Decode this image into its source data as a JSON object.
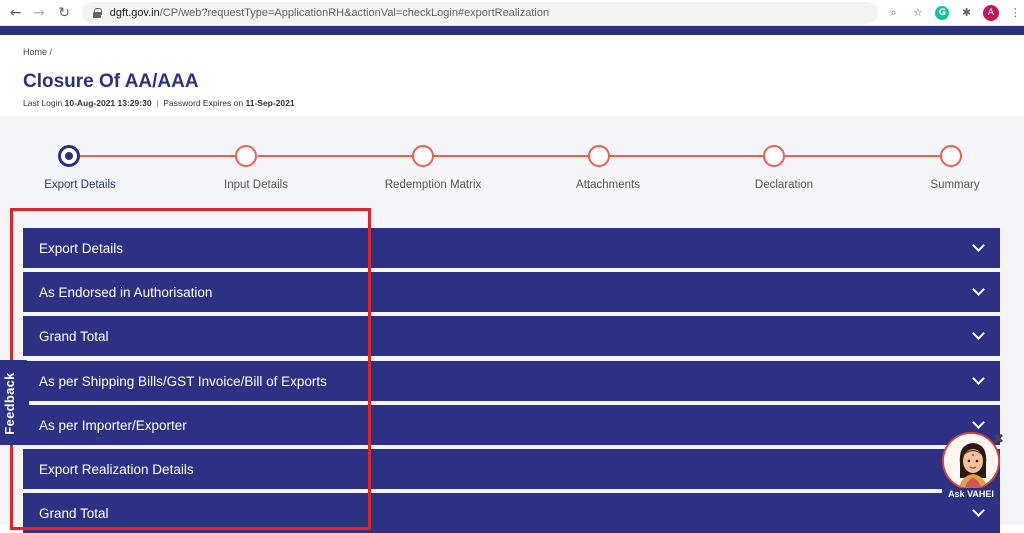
{
  "browser": {
    "url_host": "dgft.gov.in",
    "url_path": "/CP/web?requestType=ApplicationRH&actionVal=checkLogin#exportRealization",
    "extensions": {
      "grammarly": "G",
      "profile": "A"
    }
  },
  "page": {
    "breadcrumb": "Home  /",
    "title": "Closure Of AA/AAA",
    "last_login_label": "Last Login",
    "last_login_value": "10-Aug-2021 13:29:30",
    "password_label": "Password Expires on",
    "password_value": "11-Sep-2021"
  },
  "stepper": {
    "steps": [
      {
        "label": "Export Details",
        "active": true
      },
      {
        "label": "Input Details",
        "active": false
      },
      {
        "label": "Redemption Matrix",
        "active": false
      },
      {
        "label": "Attachments",
        "active": false
      },
      {
        "label": "Declaration",
        "active": false
      },
      {
        "label": "Summary",
        "active": false
      }
    ]
  },
  "accordion": {
    "sections": [
      {
        "label": "Export Details"
      },
      {
        "label": "As Endorsed in Authorisation"
      },
      {
        "label": "Grand Total"
      },
      {
        "label": "As per Shipping Bills/GST Invoice/Bill of Exports"
      },
      {
        "label": "As per Importer/Exporter"
      },
      {
        "label": "Export Realization Details"
      },
      {
        "label": "Grand Total"
      }
    ]
  },
  "widgets": {
    "feedback": "Feedback",
    "ask_vahei": "Ask VAHEI",
    "close_glyph": "✖"
  },
  "colors": {
    "brand_navy": "#2d3184",
    "step_accent": "#ec5d52",
    "highlight_red": "#e1232d"
  }
}
